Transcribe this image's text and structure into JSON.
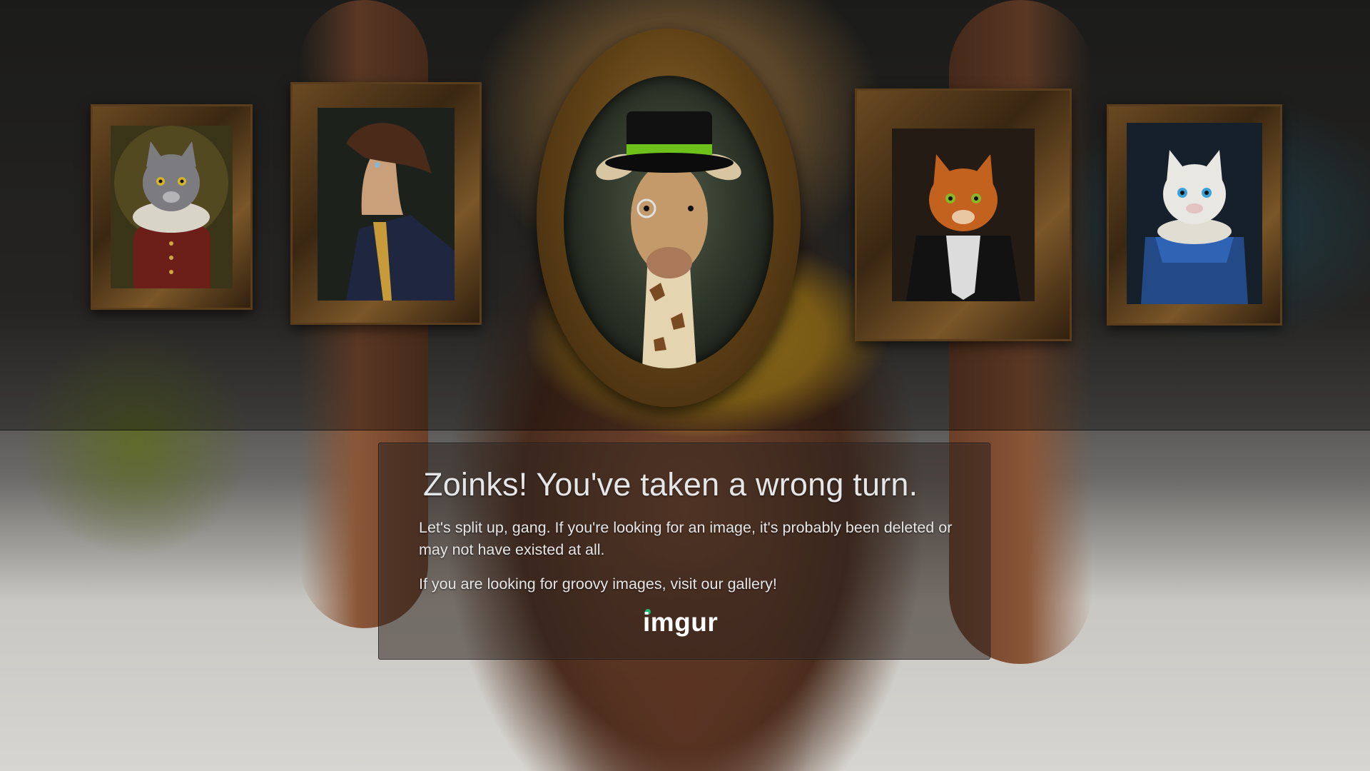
{
  "error": {
    "heading": "Zoinks! You've taken a wrong turn.",
    "message_1": "Let's split up, gang. If you're looking for an image, it's probably been deleted or may not have existed at all.",
    "message_2": "If you are looking for groovy images, visit our gallery!"
  },
  "logo": {
    "text": "imgur",
    "dot_color": "#1bb76e"
  },
  "portraits": [
    {
      "subject": "grey-cat-ruff-collar"
    },
    {
      "subject": "horse-naval-uniform"
    },
    {
      "subject": "giraffe-top-hat-monocle"
    },
    {
      "subject": "orange-cat-jabot"
    },
    {
      "subject": "white-cat-blue-dress"
    }
  ]
}
